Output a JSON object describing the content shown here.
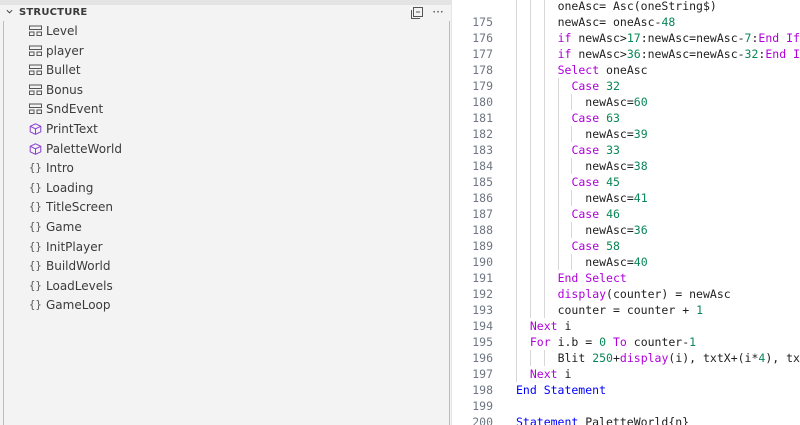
{
  "panel": {
    "title": "STRUCTURE",
    "collapse_icon": "collapse-all-icon",
    "more_label": "···",
    "items": [
      {
        "label": "Level",
        "icon": "struct-icon",
        "glyph": ""
      },
      {
        "label": "player",
        "icon": "struct-icon",
        "glyph": ""
      },
      {
        "label": "Bullet",
        "icon": "struct-icon",
        "glyph": ""
      },
      {
        "label": "Bonus",
        "icon": "struct-icon",
        "glyph": ""
      },
      {
        "label": "SndEvent",
        "icon": "struct-icon",
        "glyph": ""
      },
      {
        "label": "PrintText",
        "icon": "cube-icon",
        "glyph": ""
      },
      {
        "label": "PaletteWorld",
        "icon": "cube-icon",
        "glyph": ""
      },
      {
        "label": "Intro",
        "icon": "braces-icon",
        "glyph": "{}"
      },
      {
        "label": "Loading",
        "icon": "braces-icon",
        "glyph": "{}"
      },
      {
        "label": "TitleScreen",
        "icon": "braces-icon",
        "glyph": "{}"
      },
      {
        "label": "Game",
        "icon": "braces-icon",
        "glyph": "{}"
      },
      {
        "label": "InitPlayer",
        "icon": "braces-icon",
        "glyph": "{}"
      },
      {
        "label": "BuildWorld",
        "icon": "braces-icon",
        "glyph": "{}"
      },
      {
        "label": "LoadLevels",
        "icon": "braces-icon",
        "glyph": "{}"
      },
      {
        "label": "GameLoop",
        "icon": "braces-icon",
        "glyph": "{}"
      }
    ]
  },
  "colors": {
    "keyword_control": "#af00db",
    "keyword": "#0000ff",
    "number": "#098658",
    "text": "#1f1f1f",
    "line_number": "#6e7681",
    "panel_bg": "#f3f3f3",
    "focus_border": "#a8c2de"
  },
  "editor": {
    "lines": [
      {
        "n": "",
        "indent": 3,
        "tokens": [
          [
            "oneAsc= Asc(oneString$)",
            "text"
          ]
        ]
      },
      {
        "n": "175",
        "indent": 3,
        "tokens": [
          [
            "newAsc= oneAsc-",
            "text"
          ],
          [
            "48",
            "number"
          ]
        ]
      },
      {
        "n": "176",
        "indent": 3,
        "tokens": [
          [
            "if",
            "kc"
          ],
          [
            " newAsc>",
            "text"
          ],
          [
            "17",
            "number"
          ],
          [
            ":newAsc=newAsc-",
            "text"
          ],
          [
            "7",
            "number"
          ],
          [
            ":",
            "text"
          ],
          [
            "End If",
            "kc"
          ]
        ]
      },
      {
        "n": "177",
        "indent": 3,
        "tokens": [
          [
            "if",
            "kc"
          ],
          [
            " newAsc>",
            "text"
          ],
          [
            "36",
            "number"
          ],
          [
            ":newAsc=newAsc-",
            "text"
          ],
          [
            "32",
            "number"
          ],
          [
            ":",
            "text"
          ],
          [
            "End If",
            "kc"
          ]
        ]
      },
      {
        "n": "178",
        "indent": 3,
        "tokens": [
          [
            "Select",
            "kc"
          ],
          [
            " oneAsc",
            "text"
          ]
        ]
      },
      {
        "n": "179",
        "indent": 4,
        "tokens": [
          [
            "Case",
            "kc"
          ],
          [
            " ",
            "text"
          ],
          [
            "32",
            "number"
          ]
        ]
      },
      {
        "n": "180",
        "indent": 5,
        "tokens": [
          [
            "newAsc=",
            "text"
          ],
          [
            "60",
            "number"
          ]
        ]
      },
      {
        "n": "181",
        "indent": 4,
        "tokens": [
          [
            "Case",
            "kc"
          ],
          [
            " ",
            "text"
          ],
          [
            "63",
            "number"
          ]
        ]
      },
      {
        "n": "182",
        "indent": 5,
        "tokens": [
          [
            "newAsc=",
            "text"
          ],
          [
            "39",
            "number"
          ]
        ]
      },
      {
        "n": "183",
        "indent": 4,
        "tokens": [
          [
            "Case",
            "kc"
          ],
          [
            " ",
            "text"
          ],
          [
            "33",
            "number"
          ]
        ]
      },
      {
        "n": "184",
        "indent": 5,
        "tokens": [
          [
            "newAsc=",
            "text"
          ],
          [
            "38",
            "number"
          ]
        ]
      },
      {
        "n": "185",
        "indent": 4,
        "tokens": [
          [
            "Case",
            "kc"
          ],
          [
            " ",
            "text"
          ],
          [
            "45",
            "number"
          ]
        ]
      },
      {
        "n": "186",
        "indent": 5,
        "tokens": [
          [
            "newAsc=",
            "text"
          ],
          [
            "41",
            "number"
          ]
        ]
      },
      {
        "n": "187",
        "indent": 4,
        "tokens": [
          [
            "Case",
            "kc"
          ],
          [
            " ",
            "text"
          ],
          [
            "46",
            "number"
          ]
        ]
      },
      {
        "n": "188",
        "indent": 5,
        "tokens": [
          [
            "newAsc=",
            "text"
          ],
          [
            "36",
            "number"
          ]
        ]
      },
      {
        "n": "189",
        "indent": 4,
        "tokens": [
          [
            "Case",
            "kc"
          ],
          [
            " ",
            "text"
          ],
          [
            "58",
            "number"
          ]
        ]
      },
      {
        "n": "190",
        "indent": 5,
        "tokens": [
          [
            "newAsc=",
            "text"
          ],
          [
            "40",
            "number"
          ]
        ]
      },
      {
        "n": "191",
        "indent": 3,
        "tokens": [
          [
            "End Select",
            "kc"
          ]
        ]
      },
      {
        "n": "192",
        "indent": 3,
        "tokens": [
          [
            "display",
            "kc"
          ],
          [
            "(counter) = newAsc",
            "text"
          ]
        ]
      },
      {
        "n": "193",
        "indent": 3,
        "tokens": [
          [
            "counter = counter + ",
            "text"
          ],
          [
            "1",
            "number"
          ]
        ]
      },
      {
        "n": "194",
        "indent": 1,
        "tokens": [
          [
            "Next",
            "kc"
          ],
          [
            " i",
            "text"
          ]
        ]
      },
      {
        "n": "195",
        "indent": 1,
        "tokens": [
          [
            "For",
            "kc"
          ],
          [
            " i.b = ",
            "text"
          ],
          [
            "0",
            "number"
          ],
          [
            " ",
            "text"
          ],
          [
            "To",
            "kc"
          ],
          [
            " counter-",
            "text"
          ],
          [
            "1",
            "number"
          ]
        ]
      },
      {
        "n": "196",
        "indent": 3,
        "tokens": [
          [
            "Blit ",
            "text"
          ],
          [
            "250",
            "number"
          ],
          [
            "+",
            "text"
          ],
          [
            "display",
            "kc"
          ],
          [
            "(i), txtX+(i*",
            "text"
          ],
          [
            "4",
            "number"
          ],
          [
            "), txtY",
            "text"
          ]
        ]
      },
      {
        "n": "197",
        "indent": 1,
        "tokens": [
          [
            "Next",
            "kc"
          ],
          [
            " i",
            "text"
          ]
        ]
      },
      {
        "n": "198",
        "indent": 0,
        "tokens": [
          [
            "End Statement",
            "keyword"
          ]
        ]
      },
      {
        "n": "199",
        "indent": 0,
        "tokens": []
      },
      {
        "n": "200",
        "indent": 0,
        "tokens": [
          [
            "Statement",
            "keyword"
          ],
          [
            " PaletteWorld{n}",
            "text"
          ]
        ]
      }
    ]
  }
}
